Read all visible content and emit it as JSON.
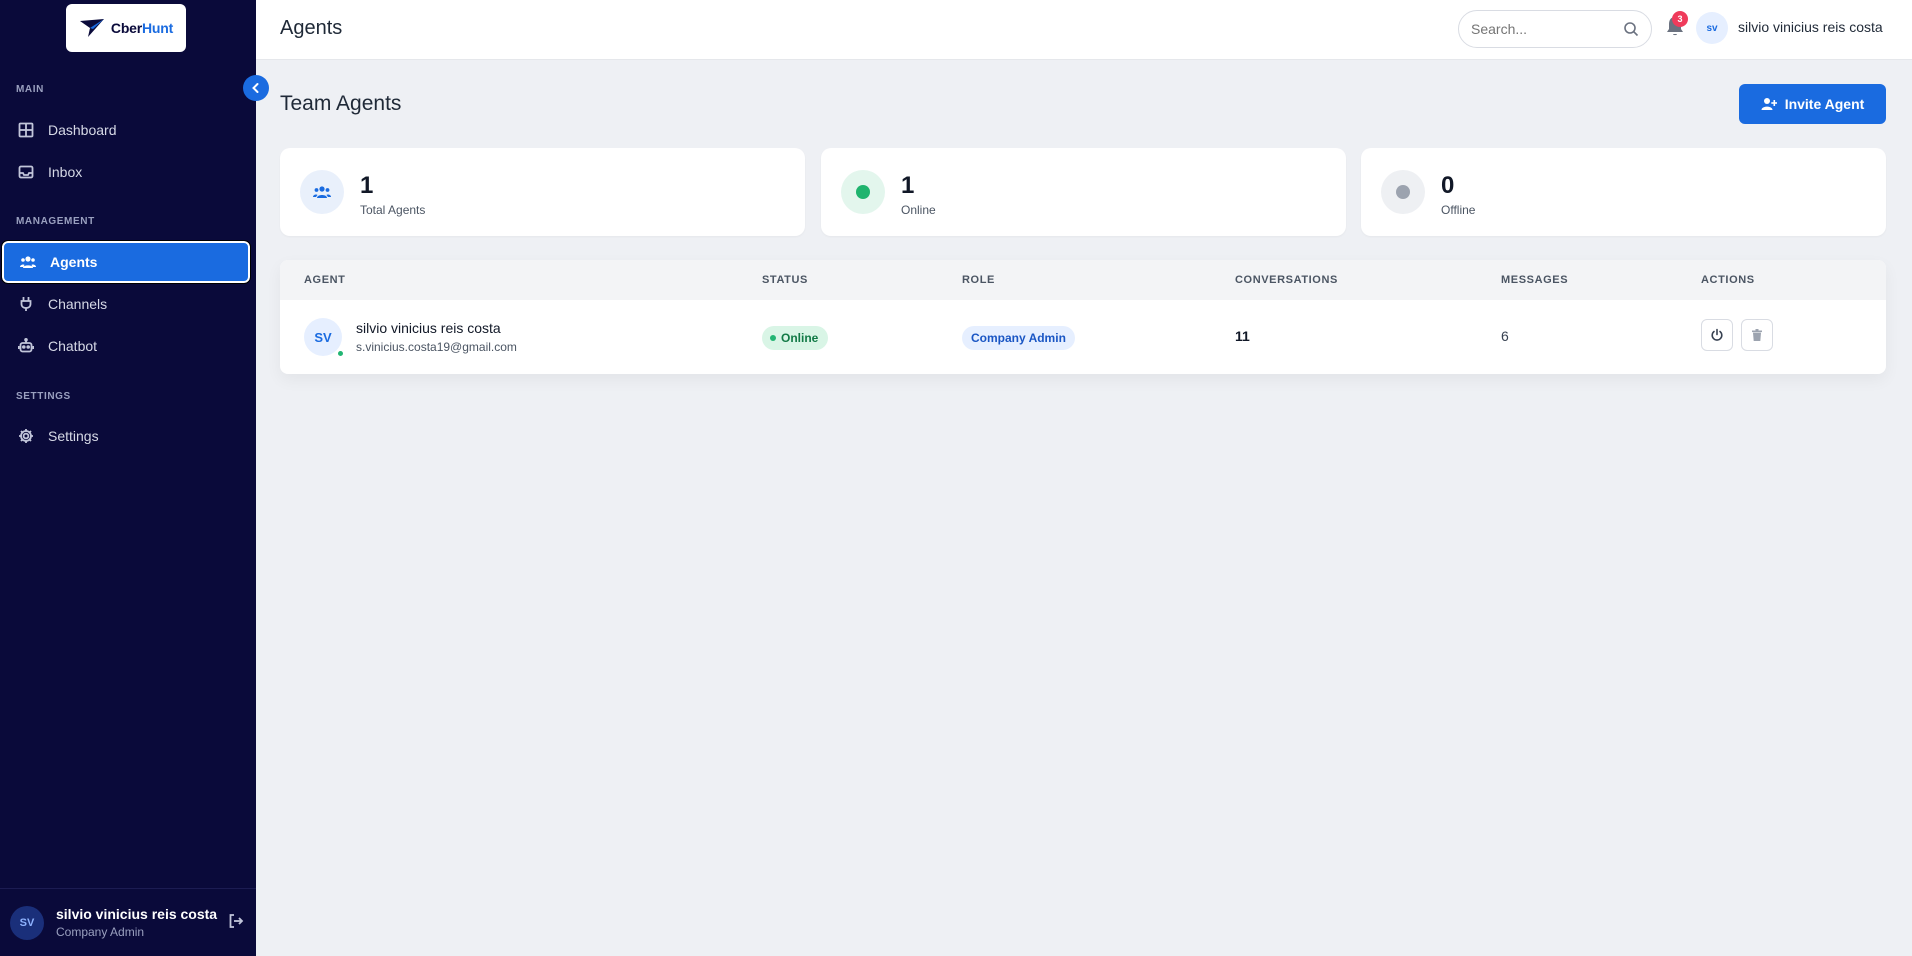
{
  "brand": {
    "name_part1": "Cber",
    "name_part2": "Hunt",
    "accent_color": "#1a6be0",
    "sidebar_color": "#0a0a3a"
  },
  "sidebar": {
    "sections": {
      "main": "MAIN",
      "management": "MANAGEMENT",
      "settings": "SETTINGS"
    },
    "items": [
      {
        "label": "Dashboard",
        "icon": "grid-icon"
      },
      {
        "label": "Inbox",
        "icon": "inbox-icon"
      },
      {
        "label": "Agents",
        "icon": "users-icon",
        "active": true
      },
      {
        "label": "Channels",
        "icon": "plug-icon"
      },
      {
        "label": "Chatbot",
        "icon": "robot-icon"
      },
      {
        "label": "Settings",
        "icon": "gear-icon"
      }
    ],
    "user": {
      "initials": "SV",
      "name": "silvio vinicius reis costa",
      "role": "Company Admin"
    }
  },
  "header": {
    "title": "Agents",
    "search_placeholder": "Search...",
    "notification_count": "3",
    "user_initials": "sv",
    "user_name": "silvio vinicius reis costa"
  },
  "main": {
    "title": "Team Agents",
    "invite_label": "Invite Agent",
    "stats": [
      {
        "value": "1",
        "label": "Total Agents"
      },
      {
        "value": "1",
        "label": "Online"
      },
      {
        "value": "0",
        "label": "Offline"
      }
    ],
    "table": {
      "headers": [
        "AGENT",
        "STATUS",
        "ROLE",
        "CONVERSATIONS",
        "MESSAGES",
        "ACTIONS"
      ],
      "rows": [
        {
          "initials": "SV",
          "name": "silvio vinicius reis costa",
          "email": "s.vinicius.costa19@gmail.com",
          "status": "Online",
          "role": "Company Admin",
          "conversations": "11",
          "messages": "6"
        }
      ]
    }
  }
}
